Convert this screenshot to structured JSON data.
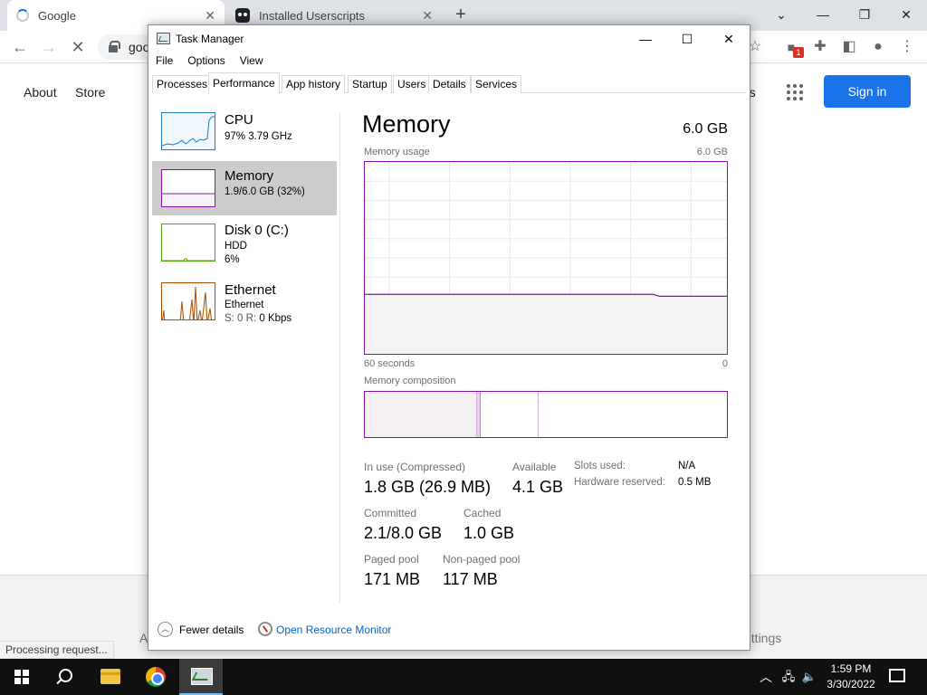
{
  "browser": {
    "tabs": [
      {
        "title": "Google",
        "icon": "loading-spinner-icon"
      },
      {
        "title": "Installed Userscripts",
        "icon": "tampermonkey-icon"
      }
    ],
    "new_tab": "+",
    "omnibox_text": "goo",
    "extension_badge": "1",
    "window_controls": [
      "chevron-down-icon",
      "minimize-icon",
      "restore-icon",
      "close-icon"
    ]
  },
  "google": {
    "links": [
      "About",
      "Store"
    ],
    "images_partial": "es",
    "signin": "Sign in",
    "footer_settings": "ettings",
    "footer_partial": "A",
    "status": "Processing request..."
  },
  "taskmgr": {
    "title": "Task Manager",
    "menu": [
      "File",
      "Options",
      "View"
    ],
    "tabs": [
      "Processes",
      "Performance",
      "App history",
      "Startup",
      "Users",
      "Details",
      "Services"
    ],
    "active_tab": "Performance",
    "sidebar": [
      {
        "name": "CPU",
        "sub1": "97%  3.79 GHz",
        "sub2": "",
        "color": "#1c7bb8"
      },
      {
        "name": "Memory",
        "sub1": "1.9/6.0 GB (32%)",
        "sub2": "",
        "color": "#8b12ae"
      },
      {
        "name": "Disk 0 (C:)",
        "sub1": "HDD",
        "sub2": "6%",
        "color": "#4da60c"
      },
      {
        "name": "Ethernet",
        "sub1": "Ethernet",
        "sub2_prefix": "S: 0 R: ",
        "sub2": "0 Kbps",
        "color": "#a74f01"
      }
    ],
    "main": {
      "heading": "Memory",
      "total": "6.0 GB",
      "usage_label": "Memory usage",
      "usage_max": "6.0 GB",
      "time_left": "60 seconds",
      "time_right": "0",
      "usage_series_pct": [
        31,
        31,
        31,
        31,
        31,
        31,
        31,
        31,
        31,
        31,
        31,
        31,
        31,
        31,
        31,
        31,
        31,
        31,
        31,
        31,
        31,
        31,
        31,
        31,
        31,
        31,
        31,
        31,
        31,
        31,
        31,
        31,
        31,
        31,
        31,
        31,
        31,
        31,
        31,
        31,
        31,
        31,
        31,
        31,
        31,
        31,
        31,
        31,
        30,
        30,
        30,
        30,
        30,
        30,
        30,
        30,
        30,
        30,
        30,
        30
      ],
      "composition_label": "Memory composition",
      "composition_pct": {
        "in_use": 31,
        "modified": 1,
        "standby": 16,
        "free": 52
      },
      "stats": {
        "in_use_label": "In use (Compressed)",
        "in_use": "1.8 GB (26.9 MB)",
        "available_label": "Available",
        "available": "4.1 GB",
        "committed_label": "Committed",
        "committed": "2.1/8.0 GB",
        "cached_label": "Cached",
        "cached": "1.0 GB",
        "paged_label": "Paged pool",
        "paged": "171 MB",
        "nonpaged_label": "Non-paged pool",
        "nonpaged": "117 MB",
        "slots_label": "Slots used:",
        "slots": "N/A",
        "hw_label": "Hardware reserved:",
        "hw": "0.5 MB"
      }
    },
    "footer": {
      "fewer_details": "Fewer details",
      "resmon": "Open Resource Monitor"
    }
  },
  "taskbar": {
    "time": "1:59 PM",
    "date": "3/30/2022"
  }
}
